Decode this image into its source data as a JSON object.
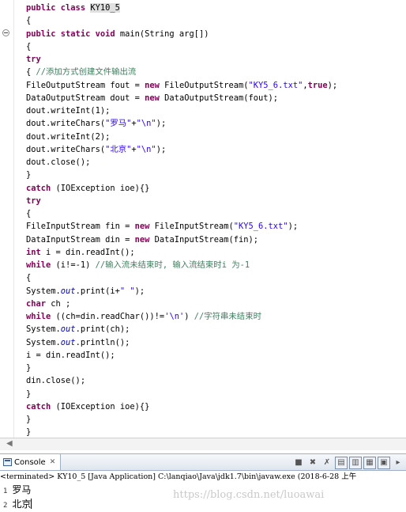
{
  "editor": {
    "lines": [
      [
        {
          "t": "public class ",
          "c": "kw"
        },
        {
          "t": "KY10_5",
          "c": "hl"
        }
      ],
      [
        {
          "t": "{",
          "c": ""
        }
      ],
      [
        {
          "t": "public static void ",
          "c": "kw"
        },
        {
          "t": "main(String arg[])",
          "c": ""
        }
      ],
      [
        {
          "t": "{",
          "c": ""
        }
      ],
      [
        {
          "t": "try",
          "c": "kw"
        }
      ],
      [
        {
          "t": "{ ",
          "c": ""
        },
        {
          "t": "//添加方式创建文件输出流",
          "c": "cm"
        }
      ],
      [
        {
          "t": "FileOutputStream fout = ",
          "c": ""
        },
        {
          "t": "new ",
          "c": "kw"
        },
        {
          "t": "FileOutputStream(",
          "c": ""
        },
        {
          "t": "\"KY5_6.txt\"",
          "c": "str"
        },
        {
          "t": ",",
          "c": ""
        },
        {
          "t": "true",
          "c": "kw"
        },
        {
          "t": ");",
          "c": ""
        }
      ],
      [
        {
          "t": "DataOutputStream dout = ",
          "c": ""
        },
        {
          "t": "new ",
          "c": "kw"
        },
        {
          "t": "DataOutputStream(fout);",
          "c": ""
        }
      ],
      [
        {
          "t": "dout.writeInt(1);",
          "c": ""
        }
      ],
      [
        {
          "t": "dout.writeChars(",
          "c": ""
        },
        {
          "t": "\"罗马\"",
          "c": "str"
        },
        {
          "t": "+",
          "c": ""
        },
        {
          "t": "\"\\n\"",
          "c": "str"
        },
        {
          "t": ");",
          "c": ""
        }
      ],
      [
        {
          "t": "dout.writeInt(2);",
          "c": ""
        }
      ],
      [
        {
          "t": "dout.writeChars(",
          "c": ""
        },
        {
          "t": "\"北京\"",
          "c": "str"
        },
        {
          "t": "+",
          "c": ""
        },
        {
          "t": "\"\\n\"",
          "c": "str"
        },
        {
          "t": ");",
          "c": ""
        }
      ],
      [
        {
          "t": "dout.close();",
          "c": ""
        }
      ],
      [
        {
          "t": "}",
          "c": ""
        }
      ],
      [
        {
          "t": "catch ",
          "c": "kw"
        },
        {
          "t": "(IOException ioe){}",
          "c": ""
        }
      ],
      [
        {
          "t": "try",
          "c": "kw"
        }
      ],
      [
        {
          "t": "{",
          "c": ""
        }
      ],
      [
        {
          "t": "FileInputStream fin = ",
          "c": ""
        },
        {
          "t": "new ",
          "c": "kw"
        },
        {
          "t": "FileInputStream(",
          "c": ""
        },
        {
          "t": "\"KY5_6.txt\"",
          "c": "str"
        },
        {
          "t": ");",
          "c": ""
        }
      ],
      [
        {
          "t": "DataInputStream din = ",
          "c": ""
        },
        {
          "t": "new ",
          "c": "kw"
        },
        {
          "t": "DataInputStream(fin);",
          "c": ""
        }
      ],
      [
        {
          "t": "int ",
          "c": "kw"
        },
        {
          "t": "i = din.readInt();",
          "c": ""
        }
      ],
      [
        {
          "t": "while ",
          "c": "kw"
        },
        {
          "t": "(i!=-1) ",
          "c": ""
        },
        {
          "t": "//输入流未结束时, 输入流结束时i 为-1",
          "c": "cm"
        }
      ],
      [
        {
          "t": "{",
          "c": ""
        }
      ],
      [
        {
          "t": "System.",
          "c": ""
        },
        {
          "t": "out",
          "c": "fld"
        },
        {
          "t": ".print(i+",
          "c": ""
        },
        {
          "t": "\" \"",
          "c": "str"
        },
        {
          "t": ");",
          "c": ""
        }
      ],
      [
        {
          "t": "char ",
          "c": "kw"
        },
        {
          "t": "ch ;",
          "c": ""
        }
      ],
      [
        {
          "t": "while ",
          "c": "kw"
        },
        {
          "t": "((ch=din.readChar())!=",
          "c": ""
        },
        {
          "t": "'\\n'",
          "c": "str"
        },
        {
          "t": ") ",
          "c": ""
        },
        {
          "t": "//字符串未结束时",
          "c": "cm"
        }
      ],
      [
        {
          "t": "System.",
          "c": ""
        },
        {
          "t": "out",
          "c": "fld"
        },
        {
          "t": ".print(ch);",
          "c": ""
        }
      ],
      [
        {
          "t": "System.",
          "c": ""
        },
        {
          "t": "out",
          "c": "fld"
        },
        {
          "t": ".println();",
          "c": ""
        }
      ],
      [
        {
          "t": "i = din.readInt();",
          "c": ""
        }
      ],
      [
        {
          "t": "}",
          "c": ""
        }
      ],
      [
        {
          "t": "din.close();",
          "c": ""
        }
      ],
      [
        {
          "t": "}",
          "c": ""
        }
      ],
      [
        {
          "t": "catch ",
          "c": "kw"
        },
        {
          "t": "(IOException ioe){}",
          "c": ""
        }
      ],
      [
        {
          "t": "}",
          "c": ""
        }
      ],
      [
        {
          "t": "}",
          "c": ""
        }
      ]
    ]
  },
  "console": {
    "tab_label": "Console",
    "close_glyph": "✕",
    "status": "<terminated> KY10_5 [Java Application] C:\\lanqiao\\Java\\jdk1.7\\bin\\javaw.exe (2018-6-28 上午",
    "output": [
      {
        "num": "1",
        "text": "罗马"
      },
      {
        "num": "2",
        "text": "北京"
      }
    ],
    "toolbar_icons": [
      "stop-icon",
      "remove-launch-icon",
      "remove-all-icon",
      "clear-console-icon",
      "scroll-lock-icon",
      "pin-console-icon",
      "display-selected-icon",
      "open-console-icon"
    ]
  },
  "watermark": "https://blog.csdn.net/luoawai",
  "colors": {
    "keyword": "#7f0055",
    "string": "#2a00ff",
    "comment": "#3f7f5f",
    "field": "#0000c0"
  }
}
